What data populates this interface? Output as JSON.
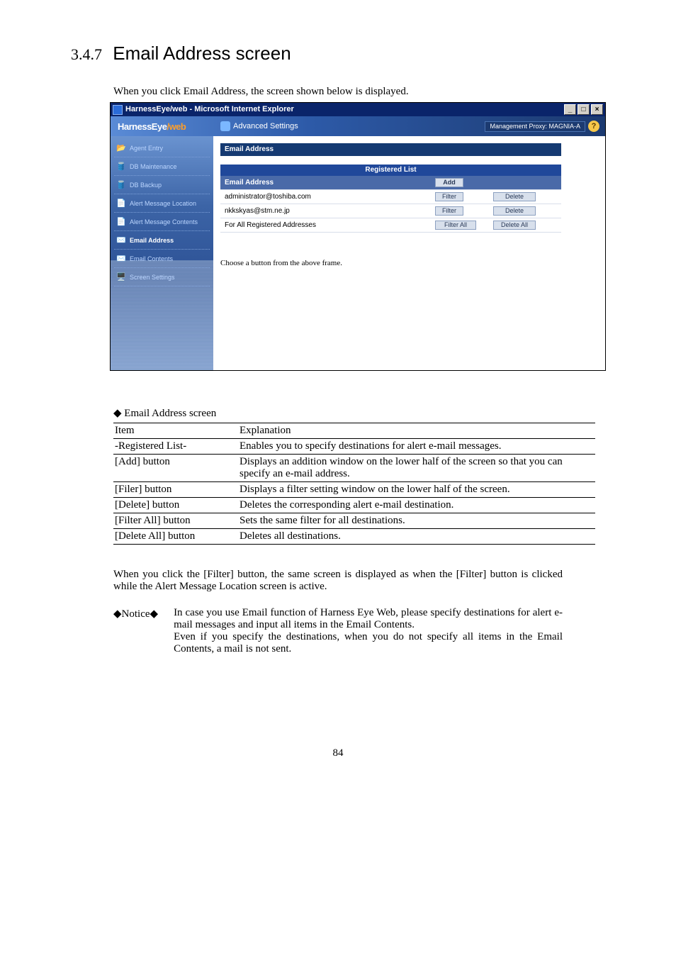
{
  "heading_num": "3.4.7",
  "heading_text": "Email Address screen",
  "intro": "When you click Email Address, the screen shown below is displayed.",
  "shot": {
    "window_title": "HarnessEye/web - Microsoft Internet Explorer",
    "brand_a": "HarnessEye",
    "brand_b": "/web",
    "adv_settings": "Advanced Settings",
    "proxy_label": "Management Proxy: MAGNIA-A",
    "help": "?",
    "sidebar": {
      "items": [
        "Agent Entry",
        "DB Maintenance",
        "DB Backup",
        "Alert Message Location",
        "Alert Message Contents",
        "Email Address",
        "Email Contents",
        "Screen Settings"
      ],
      "active_index": 5
    },
    "panel_title": "Email Address",
    "registered_list_label": "Registered List",
    "col_header": "Email Address",
    "add_btn": "Add",
    "rows": [
      {
        "addr": "administrator@toshiba.com",
        "filter": "Filter",
        "del": "Delete"
      },
      {
        "addr": "nkkskyas@stm.ne.jp",
        "filter": "Filter",
        "del": "Delete"
      }
    ],
    "all_row": {
      "label": "For All Registered Addresses",
      "filter": "Filter All",
      "del": "Delete All"
    },
    "lower_msg": "Choose a button from the above frame."
  },
  "table_caption": "◆ Email Address screen",
  "table": {
    "headers": [
      "Item",
      "Explanation"
    ],
    "rows": [
      {
        "item": "-Registered List-",
        "expl": "Enables you to specify destinations for alert e-mail messages."
      },
      {
        "item": "[Add] button",
        "expl": "Displays an addition window on the lower half of the screen so that you can specify an e-mail address."
      },
      {
        "item": "[Filer] button",
        "expl": "Displays a filter setting window on the lower half of the screen."
      },
      {
        "item": "[Delete] button",
        "expl": "Deletes the corresponding alert e-mail destination."
      },
      {
        "item": "[Filter All] button",
        "expl": "Sets the same filter for all destinations."
      },
      {
        "item": "[Delete All] button",
        "expl": "Deletes all destinations."
      }
    ]
  },
  "para": "When you click the [Filter] button, the same screen is displayed as when the [Filter] button is clicked while the Alert Message Location screen is active.",
  "notice_label": "◆Notice◆",
  "notice_text_1": "In case you use Email function of Harness Eye Web, please specify destinations for alert e-mail messages and input all items in the Email Contents.",
  "notice_text_2": "Even if you specify the destinations, when you do not specify all items in the Email Contents, a mail is not sent.",
  "page_number": "84"
}
